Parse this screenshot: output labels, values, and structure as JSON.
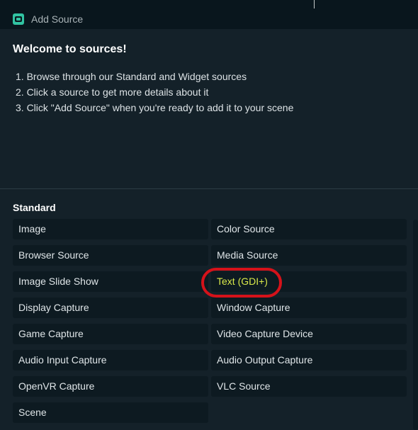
{
  "window": {
    "title": "Add Source",
    "icon": "streamlabs-logo-icon"
  },
  "welcome": {
    "heading": "Welcome to sources!",
    "steps": [
      "1. Browse through our Standard and Widget sources",
      "2. Click a source to get more details about it",
      "3. Click \"Add Source\" when you're ready to add it to your scene"
    ]
  },
  "standard": {
    "title": "Standard",
    "sources": [
      "Image",
      "Color Source",
      "Browser Source",
      "Media Source",
      "Image Slide Show",
      "Text (GDI+)",
      "Display Capture",
      "Window Capture",
      "Game Capture",
      "Video Capture Device",
      "Audio Input Capture",
      "Audio Output Capture",
      "OpenVR Capture",
      "VLC Source",
      "Scene"
    ]
  },
  "colors": {
    "accent": "#31c3a2",
    "annotation_circle": "#d5121a",
    "highlight_text": "#d9e84a"
  }
}
